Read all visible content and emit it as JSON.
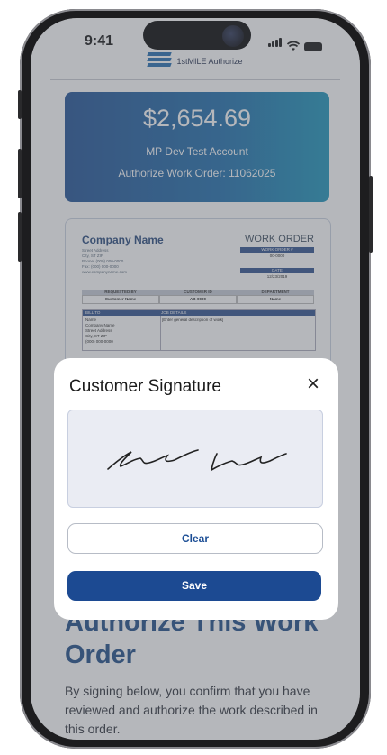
{
  "status_bar": {
    "time": "9:41"
  },
  "app": {
    "logo_text": "1stMILE Authorize"
  },
  "summary": {
    "amount": "$2,654.69",
    "account": "MP Dev Test Account",
    "work_order_line": "Authorize Work Order: 11062025"
  },
  "work_order_doc": {
    "company_name": "Company Name",
    "address_lines": [
      "Street Address",
      "City, ST ZIP",
      "Phone: (000) 000-0000",
      "Fax: (000) 000-0000",
      "www.companyname.com"
    ],
    "title": "WORK ORDER",
    "work_order_no_label": "WORK ORDER #",
    "work_order_no": "00-0000",
    "date_label": "DATE",
    "date": "12/23/2019",
    "columns": [
      "REQUESTED BY",
      "CUSTOMER ID",
      "DEPARTMENT"
    ],
    "values": [
      "Customer Name",
      "AB-0000",
      "Name"
    ],
    "bill_to_label": "BILL TO",
    "job_details_label": "JOB DETAILS",
    "bill_to_lines": [
      "Name",
      "Company Name",
      "Street Address",
      "City, ST ZIP",
      "(000) 000-0000"
    ],
    "job_details": "[Enter general description of work]"
  },
  "page": {
    "heading": "Authorize This Work Order",
    "paragraph": "By signing below, you confirm that you have reviewed and authorize the work described in this order."
  },
  "modal": {
    "title": "Customer Signature",
    "close_icon": "close-icon",
    "clear_label": "Clear",
    "save_label": "Save"
  },
  "colors": {
    "primary": "#1c4a92",
    "card_gradient_start": "#1d4e93",
    "card_gradient_end": "#1993b9",
    "heading": "#1b4a86"
  }
}
